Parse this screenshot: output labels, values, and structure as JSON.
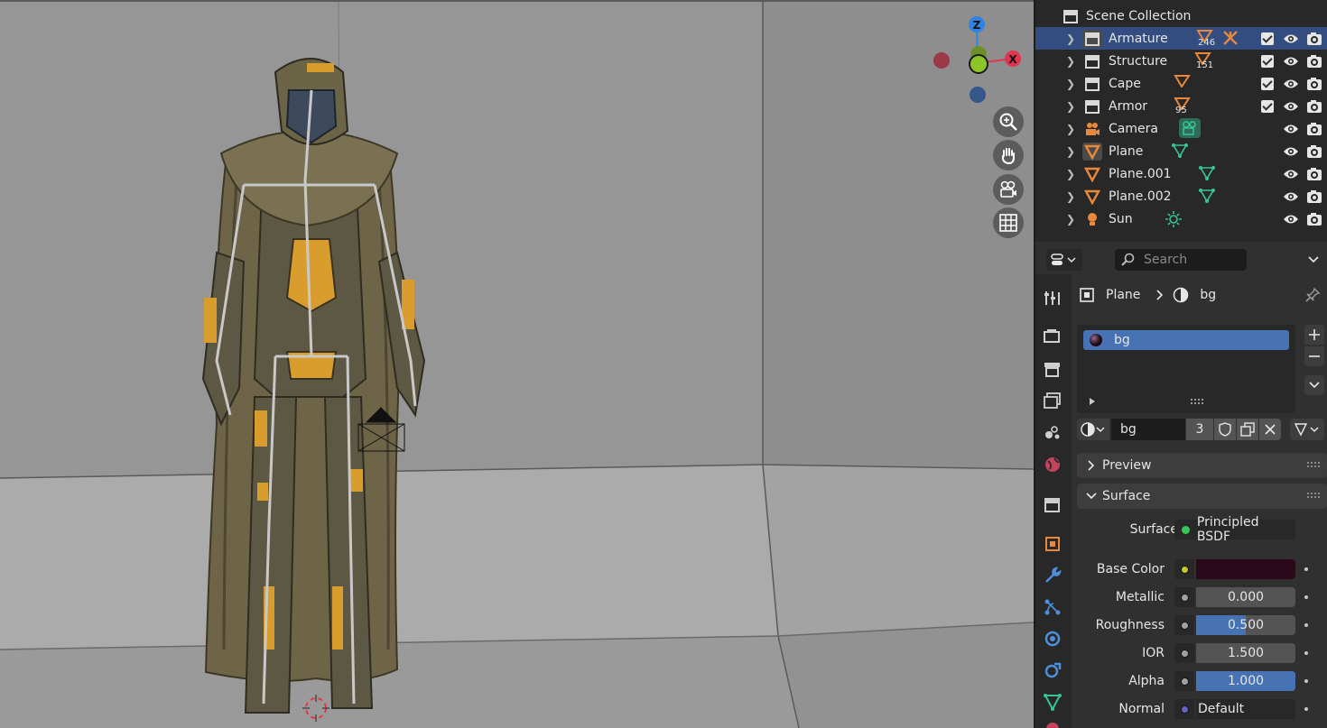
{
  "outliner": {
    "root_label": "Scene Collection",
    "items": [
      {
        "name": "Armature",
        "badge_count": "246",
        "selected": true,
        "has_checkbox": true
      },
      {
        "name": "Structure",
        "badge_count": "151",
        "selected": false,
        "has_checkbox": true
      },
      {
        "name": "Cape",
        "badge_count": "",
        "selected": false,
        "has_checkbox": true
      },
      {
        "name": "Armor",
        "badge_count": "95",
        "selected": false,
        "has_checkbox": true
      },
      {
        "name": "Camera",
        "badge_count": "",
        "selected": false,
        "has_checkbox": false
      },
      {
        "name": "Plane",
        "badge_count": "",
        "selected": false,
        "has_checkbox": false
      },
      {
        "name": "Plane.001",
        "badge_count": "",
        "selected": false,
        "has_checkbox": false
      },
      {
        "name": "Plane.002",
        "badge_count": "",
        "selected": false,
        "has_checkbox": false
      },
      {
        "name": "Sun",
        "badge_count": "",
        "selected": false,
        "has_checkbox": false
      }
    ]
  },
  "properties": {
    "search_placeholder": "Search",
    "breadcrumb": {
      "object": "Plane",
      "material": "bg"
    },
    "slot_list": [
      "bg"
    ],
    "material_name": "bg",
    "user_count": "3",
    "panels": {
      "preview": "Preview",
      "surface": "Surface"
    },
    "surface": {
      "surface_label": "Surface",
      "surface_value": "Principled BSDF",
      "base_color_label": "Base Color",
      "base_color": "#2a0a1a",
      "metallic_label": "Metallic",
      "metallic_value": "0.000",
      "roughness_label": "Roughness",
      "roughness_value": "0.500",
      "roughness_fraction": 0.5,
      "ior_label": "IOR",
      "ior_value": "1.500",
      "alpha_label": "Alpha",
      "alpha_value": "1.000",
      "alpha_fraction": 1.0,
      "normal_label": "Normal",
      "normal_value": "Default"
    }
  },
  "gizmo": {
    "z": "Z",
    "y": "Y",
    "x": "X"
  },
  "colors": {
    "accent_blue": "#4772b3",
    "selection": "#334d80",
    "axis_x": "#e0344f",
    "axis_y": "#8bc527",
    "axis_z": "#2f84e3",
    "mesh_orange": "#e8883a",
    "data_green": "#35c692"
  }
}
